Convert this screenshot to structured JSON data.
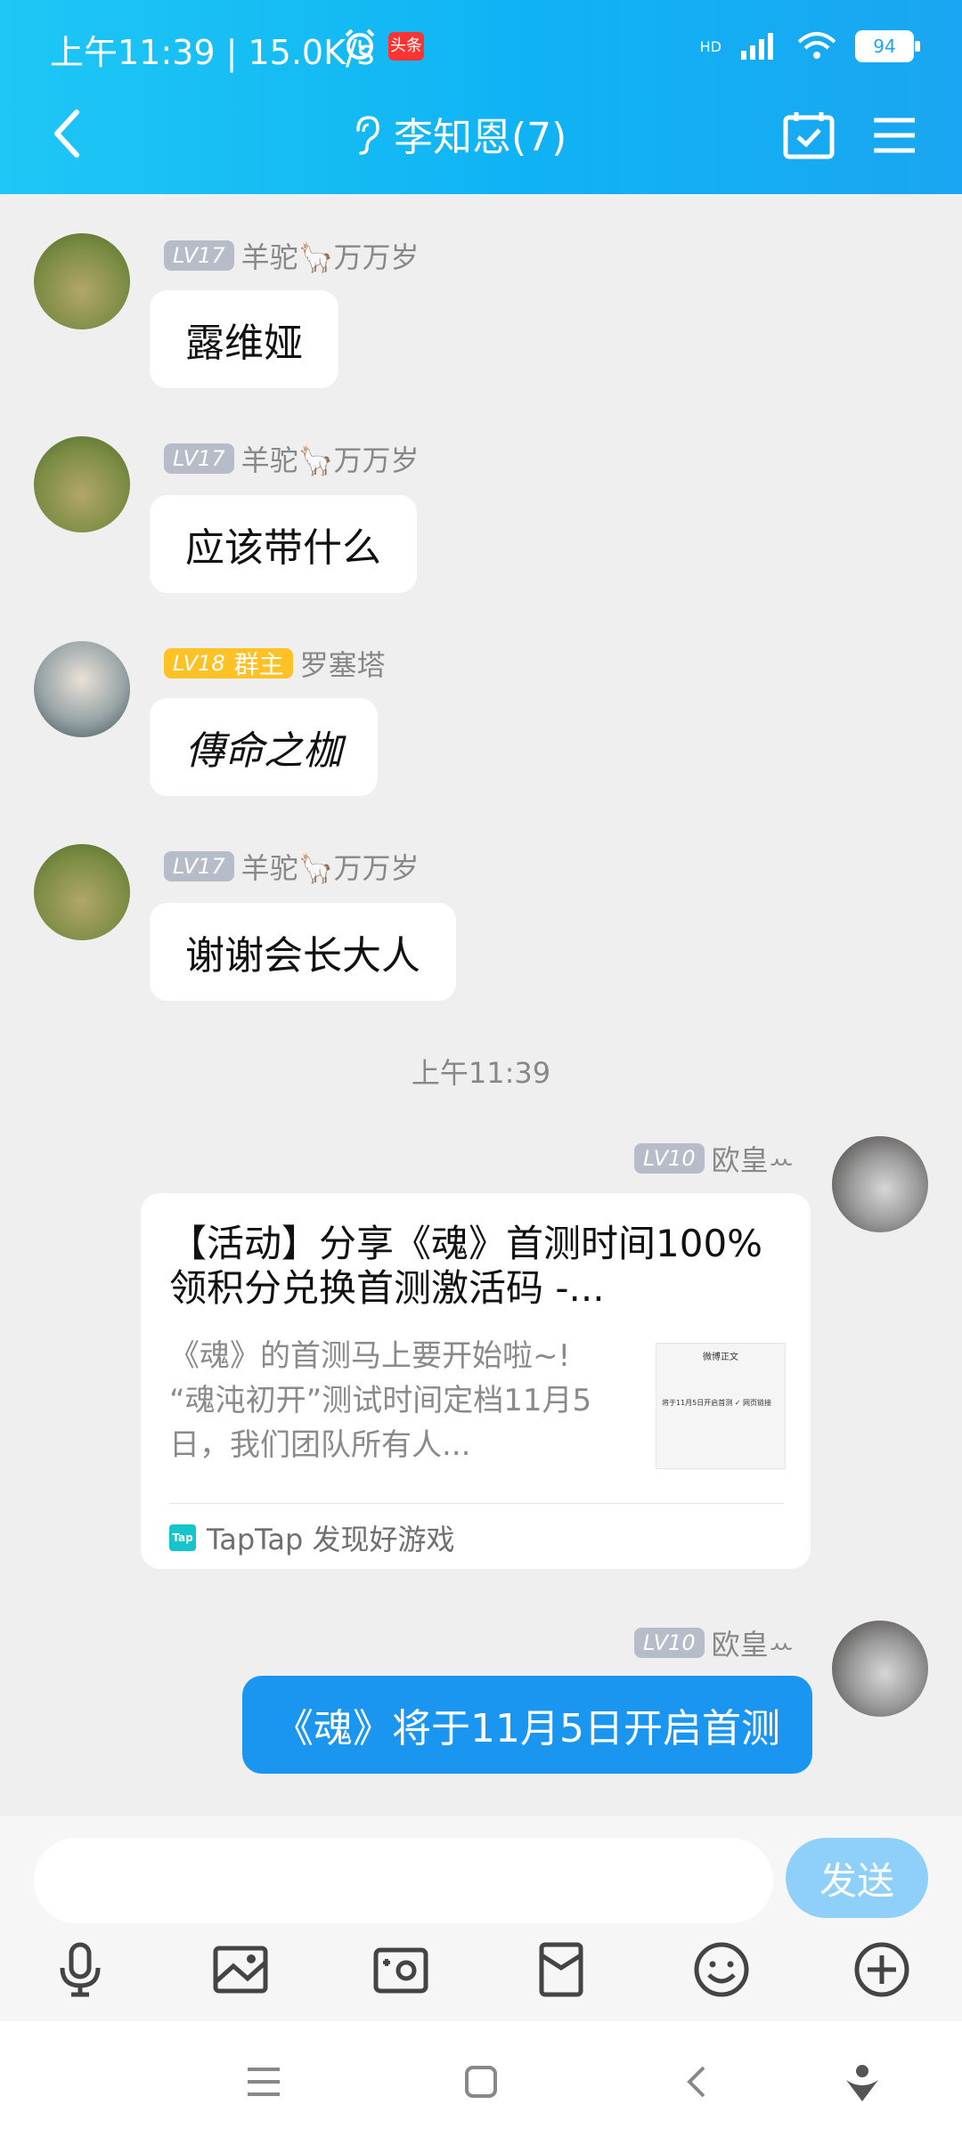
{
  "status_bar": {
    "time_speed": "上午11:39 | 15.0K/s",
    "news_badge": "头条",
    "hd": "HD",
    "battery": "94"
  },
  "header": {
    "title": "李知恩(7)"
  },
  "messages": [
    {
      "level": "LV17",
      "name": "羊驼🦙万万岁",
      "text": "露维娅"
    },
    {
      "level": "LV17",
      "name": "羊驼🦙万万岁",
      "text": "应该带什么"
    },
    {
      "level": "LV18",
      "role": "群主",
      "name": "罗塞塔",
      "text": "傳命之枷"
    },
    {
      "level": "LV17",
      "name": "羊驼🦙万万岁",
      "text": "谢谢会长大人"
    }
  ],
  "time_divider": "上午11:39",
  "my_messages": [
    {
      "level": "LV10",
      "name": "欧皇ꕀ"
    },
    {
      "level": "LV10",
      "name": "欧皇ꕀ"
    }
  ],
  "link_card": {
    "title": "【活动】分享《魂》首测时间100%领积分兑换首测激活码 -...",
    "description": "《魂》的首测马上要开始啦~! “魂沌初开”测试时间定档11月5日，我们团队所有人...",
    "thumb_title": "微博正文",
    "thumb_text": "将于11月5日开启首测 ✓ 网页链接",
    "source": "TapTap 发现好游戏",
    "source_logo": "Tap"
  },
  "my_text": "《魂》将于11月5日开启首测",
  "input": {
    "placeholder": "",
    "send_label": "发送"
  },
  "colors": {
    "accent": "#1a96f0",
    "header": "#12b3f4"
  }
}
